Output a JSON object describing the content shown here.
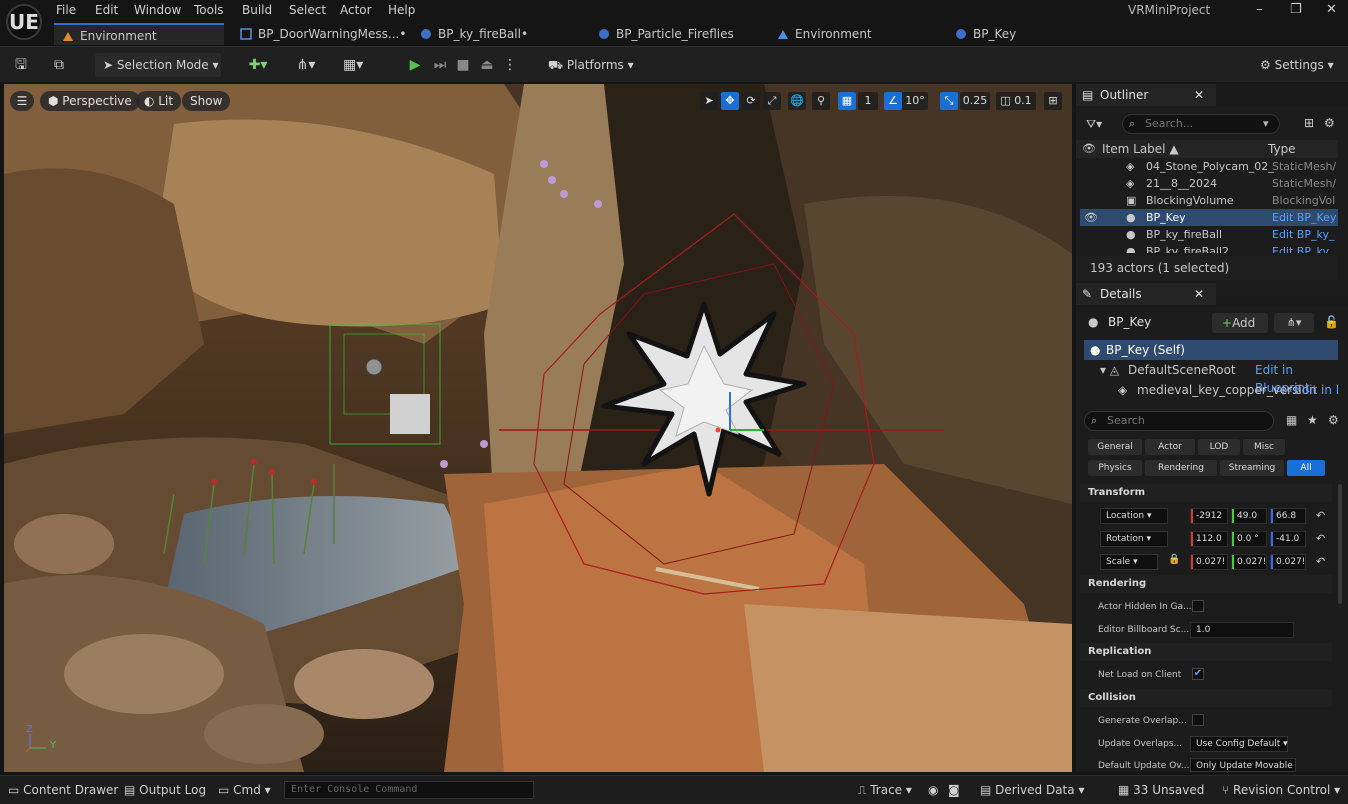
{
  "app": {
    "project_name": "VRMiniProject",
    "logo": "UE"
  },
  "menu": [
    "File",
    "Edit",
    "Window",
    "Tools",
    "Build",
    "Select",
    "Actor",
    "Help"
  ],
  "window_controls": {
    "minimize": "–",
    "restore": "❐",
    "close": "✕"
  },
  "tabs": [
    {
      "label": "Environment",
      "icon": "level-icon",
      "active": true
    },
    {
      "label": "BP_DoorWarningMess...•",
      "icon": "blueprint-icon"
    },
    {
      "label": "BP_ky_fireBall•",
      "icon": "blueprint-icon"
    },
    {
      "label": "BP_Particle_Fireflies",
      "icon": "blueprint-icon"
    },
    {
      "label": "Environment",
      "icon": "level-icon"
    },
    {
      "label": "BP_Key",
      "icon": "blueprint-icon"
    }
  ],
  "toolbar": {
    "selection_mode": "Selection Mode",
    "platforms": "Platforms",
    "settings": "Settings"
  },
  "viewport": {
    "perspective": "Perspective",
    "lit": "Lit",
    "show": "Show",
    "grid_value": "1",
    "rotation_snap": "10°",
    "scale_snap": "0.25",
    "camera_speed": "0.1",
    "axis_z": "Z",
    "axis_y": "Y"
  },
  "outliner": {
    "title": "Outliner",
    "search_placeholder": "Search...",
    "col_label": "Item Label ▲",
    "col_type": "Type",
    "rows": [
      {
        "label": "04_Stone_Polycam_02_",
        "type": "StaticMesh/"
      },
      {
        "label": "21__8__2024",
        "type": "StaticMesh/"
      },
      {
        "label": "BlockingVolume",
        "type": "BlockingVol"
      },
      {
        "label": "BP_Key",
        "type": "Edit BP_Key"
      },
      {
        "label": "BP_ky_fireBall",
        "type": "Edit BP_ky_"
      },
      {
        "label": "BP_ky_fireBall2",
        "type": "Edit BP_ky"
      }
    ],
    "footer": "193 actors (1 selected)"
  },
  "details": {
    "title": "Details",
    "actor_name": "BP_Key",
    "add_label": "Add",
    "components": [
      {
        "label": "BP_Key (Self)",
        "link": ""
      },
      {
        "label": "DefaultSceneRoot",
        "link": "Edit in Blueprint"
      },
      {
        "label": "medieval_key_copper_version",
        "link": "Edit in Bl"
      }
    ],
    "search_placeholder": "Search",
    "filter_tabs": [
      "General",
      "Actor",
      "LOD",
      "Misc",
      "Physics",
      "Rendering",
      "Streaming",
      "All"
    ],
    "transform_title": "Transform",
    "location_label": "Location",
    "location": [
      "-2912",
      "49.0",
      "66.8"
    ],
    "rotation_label": "Rotation",
    "rotation": [
      "112.0",
      "0.0 °",
      "-41.0"
    ],
    "scale_label": "Scale",
    "scale": [
      "0.027!",
      "0.027!",
      "0.027!"
    ],
    "rendering_title": "Rendering",
    "actor_hidden_label": "Actor Hidden In Ga...",
    "editor_billboard_label": "Editor Billboard Sc...",
    "editor_billboard_value": "1.0",
    "replication_title": "Replication",
    "net_load_label": "Net Load on Client",
    "collision_title": "Collision",
    "generate_overlap_label": "Generate Overlap...",
    "update_overlaps_label": "Update Overlaps...",
    "update_overlaps_value": "Use Config Default",
    "default_update_label": "Default Update Ov...",
    "default_update_value": "Only Update Movable"
  },
  "statusbar": {
    "content_drawer": "Content Drawer",
    "output_log": "Output Log",
    "cmd": "Cmd",
    "console_placeholder": "Enter Console Command",
    "trace": "Trace",
    "derived_data": "Derived Data",
    "unsaved": "33 Unsaved",
    "revision_control": "Revision Control"
  }
}
